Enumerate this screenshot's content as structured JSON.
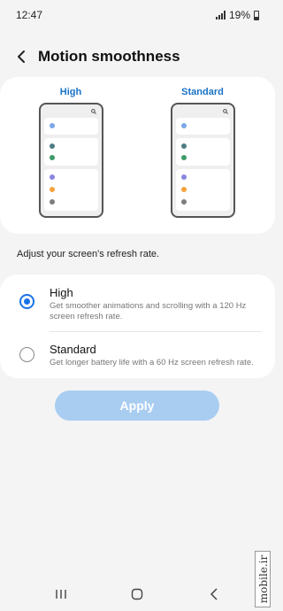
{
  "status_bar": {
    "time": "12:47",
    "battery": "19%"
  },
  "header": {
    "title": "Motion smoothness"
  },
  "preview": {
    "high_label": "High",
    "standard_label": "Standard",
    "colors": {
      "blue": "#7aa8e8",
      "teal": "#4f7c84",
      "green": "#3f9b6a",
      "purple": "#8a86e0",
      "orange": "#f4a33a",
      "gray": "#7d7d7d"
    }
  },
  "subtitle": "Adjust your screen's refresh rate.",
  "options": [
    {
      "title": "High",
      "description": "Get smoother animations and scrolling with a 120 Hz screen refresh rate.",
      "selected": true
    },
    {
      "title": "Standard",
      "description": "Get longer battery life with a 60 Hz screen refresh rate.",
      "selected": false
    }
  ],
  "apply_label": "Apply",
  "watermark": "mobile.ir",
  "navbar": {
    "icons": [
      "recents-icon",
      "home-icon",
      "back-icon"
    ]
  }
}
